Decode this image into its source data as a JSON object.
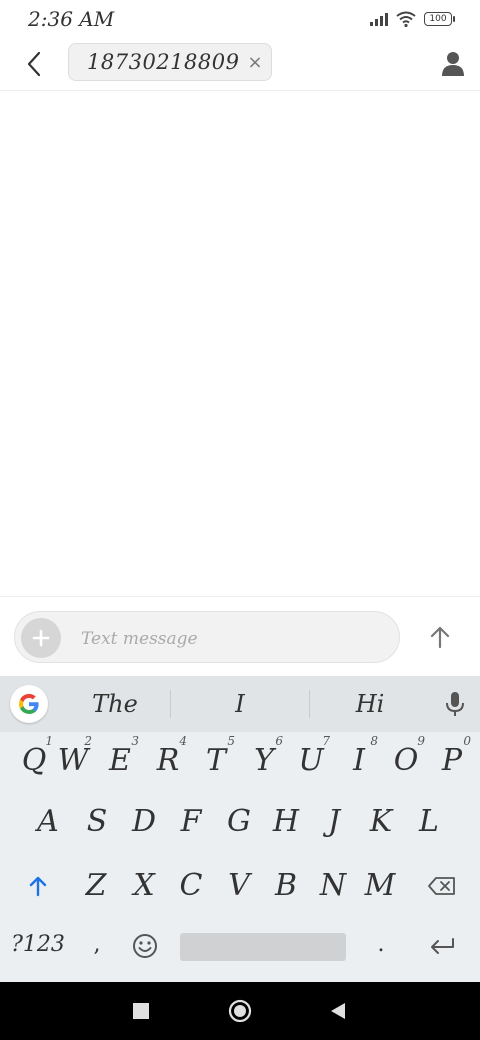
{
  "status_bar": {
    "time": "2:36 AM",
    "battery": "100"
  },
  "header": {
    "recipient": "18730218809",
    "remove_symbol": "×"
  },
  "compose": {
    "placeholder": "Text message",
    "value": ""
  },
  "keyboard": {
    "suggestions": [
      "The",
      "I",
      "Hi"
    ],
    "row1": [
      {
        "label": "Q",
        "hint": "1"
      },
      {
        "label": "W",
        "hint": "2"
      },
      {
        "label": "E",
        "hint": "3"
      },
      {
        "label": "R",
        "hint": "4"
      },
      {
        "label": "T",
        "hint": "5"
      },
      {
        "label": "Y",
        "hint": "6"
      },
      {
        "label": "U",
        "hint": "7"
      },
      {
        "label": "I",
        "hint": "8"
      },
      {
        "label": "O",
        "hint": "9"
      },
      {
        "label": "P",
        "hint": "0"
      }
    ],
    "row2": [
      "A",
      "S",
      "D",
      "F",
      "G",
      "H",
      "J",
      "K",
      "L"
    ],
    "row3": [
      "Z",
      "X",
      "C",
      "V",
      "B",
      "N",
      "M"
    ],
    "symbols_label": "?123",
    "comma_label": ",",
    "period_label": "."
  },
  "colors": {
    "accent_blue": "#1a73e8",
    "keyboard_bg": "#eceff1",
    "suggestion_bg": "#e1e4e6"
  }
}
